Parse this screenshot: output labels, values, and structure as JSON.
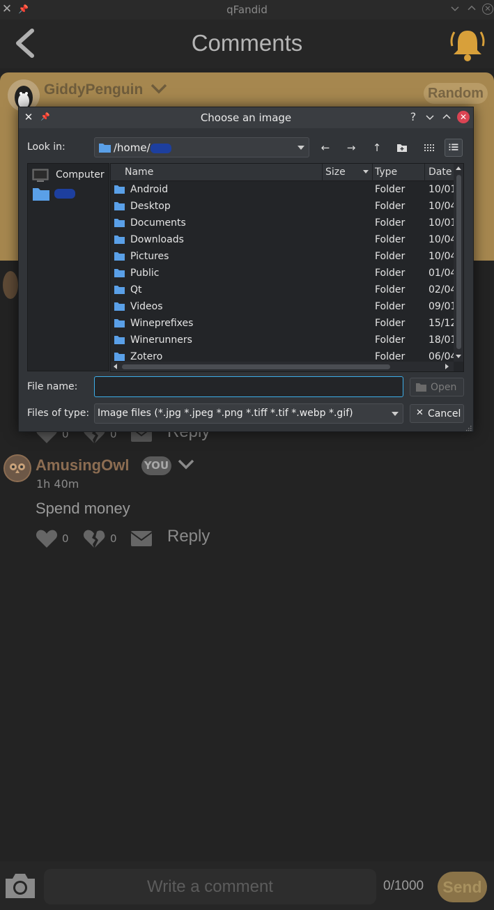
{
  "window": {
    "title": "qFandid"
  },
  "header": {
    "title": "Comments"
  },
  "post": {
    "username": "GiddyPenguin",
    "badge": "Random"
  },
  "comment1": {
    "likes": "0",
    "dislikes": "0",
    "reply_label": "Reply"
  },
  "comment2": {
    "username": "AmusingOwl",
    "you_badge": "YOU",
    "time": "1h 40m",
    "text": "Spend money",
    "likes": "0",
    "dislikes": "0",
    "reply_label": "Reply"
  },
  "composer": {
    "placeholder": "Write a comment",
    "count": "0/1000",
    "send_label": "Send"
  },
  "dialog": {
    "title": "Choose an image",
    "help": "?",
    "look_in_label": "Look in:",
    "look_in_path": "/home/",
    "sidebar": [
      {
        "label": "Computer",
        "icon": "computer-icon"
      },
      {
        "label": "",
        "icon": "folder-icon"
      }
    ],
    "columns": {
      "name": "Name",
      "size": "Size",
      "type": "Type",
      "date": "Date"
    },
    "files": [
      {
        "name": "Android",
        "type": "Folder",
        "date": "10/01"
      },
      {
        "name": "Desktop",
        "type": "Folder",
        "date": "10/04"
      },
      {
        "name": "Documents",
        "type": "Folder",
        "date": "10/01"
      },
      {
        "name": "Downloads",
        "type": "Folder",
        "date": "10/04"
      },
      {
        "name": "Pictures",
        "type": "Folder",
        "date": "10/04"
      },
      {
        "name": "Public",
        "type": "Folder",
        "date": "01/04"
      },
      {
        "name": "Qt",
        "type": "Folder",
        "date": "02/04"
      },
      {
        "name": "Videos",
        "type": "Folder",
        "date": "09/01"
      },
      {
        "name": "Wineprefixes",
        "type": "Folder",
        "date": "15/12"
      },
      {
        "name": "Winerunners",
        "type": "Folder",
        "date": "18/01"
      },
      {
        "name": "Zotero",
        "type": "Folder",
        "date": "06/04"
      }
    ],
    "file_name_label": "File name:",
    "file_name_value": "",
    "open_label": "Open",
    "files_of_type_label": "Files of type:",
    "files_of_type_value": "Image files (*.jpg *.jpeg *.png *.tiff *.tif *.webp *.gif)",
    "cancel_label": "Cancel"
  },
  "colors": {
    "accent": "#3daee9",
    "folder": "#5aa0e8",
    "card": "#a6874f",
    "send": "#8a7348"
  }
}
